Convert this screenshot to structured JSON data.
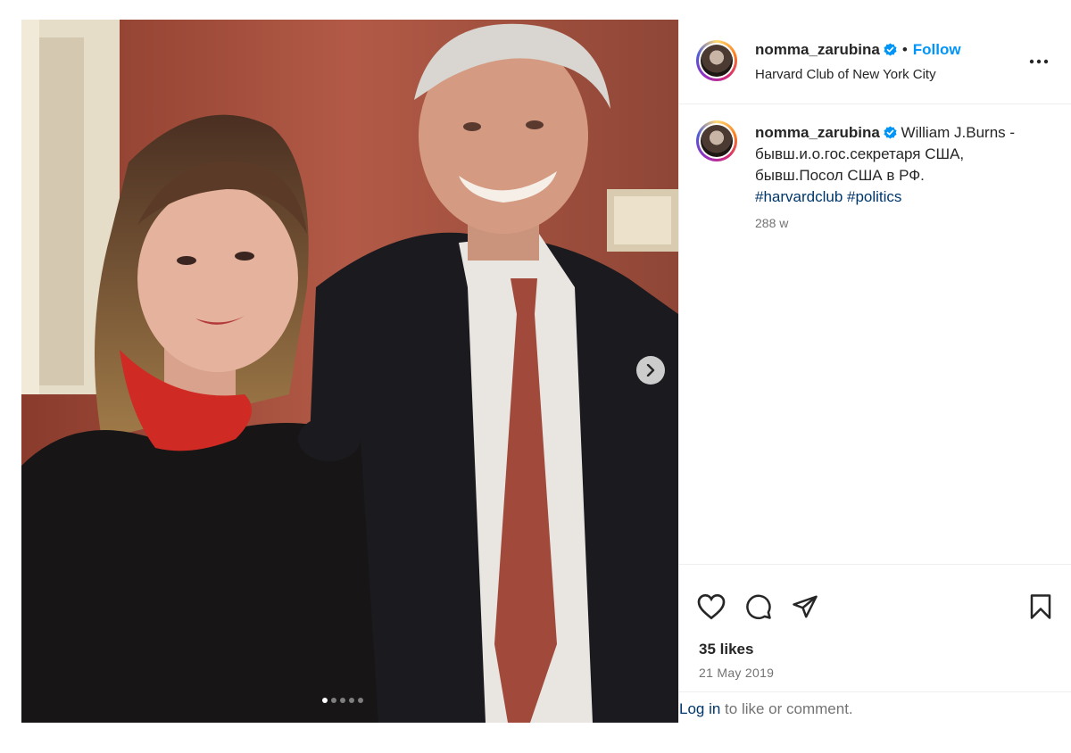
{
  "post": {
    "username": "nomma_zarubina",
    "follow_label": "Follow",
    "separator": "•",
    "location": "Harvard Club of New York City",
    "caption_text": "William J.Burns - бывш.и.о.гос.секретаря США, бывш.Посол США в РФ.",
    "hashtags": [
      "#harvardclub",
      "#politics"
    ],
    "time_ago": "288 w",
    "likes": "35 likes",
    "date": "21 May 2019",
    "login_link": "Log in",
    "login_suffix": " to like or comment.",
    "carousel": {
      "total": 5,
      "active_index": 0
    }
  },
  "icons": {
    "verified": "verified-badge-icon",
    "more": "more-options-icon",
    "like": "heart-icon",
    "comment": "comment-icon",
    "share": "paper-plane-icon",
    "save": "bookmark-icon",
    "next": "chevron-right-icon"
  },
  "colors": {
    "accent": "#0095f6",
    "hashtag": "#00376b",
    "secondary_text": "#737373"
  }
}
